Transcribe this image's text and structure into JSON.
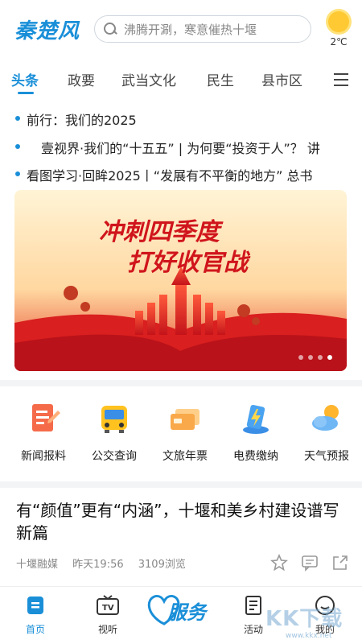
{
  "header": {
    "logo": "秦楚风",
    "search_placeholder": "沸腾开涮，寒意催热十堰",
    "weather": {
      "icon": "sun-icon",
      "temperature": "2℃"
    }
  },
  "tabs": {
    "items": [
      "头条",
      "政要",
      "武当文化",
      "民生",
      "县市区"
    ],
    "active_index": 0,
    "accent": "#1a8fd8"
  },
  "headlines": [
    "前行：我们的2025",
    "壹视界·我们的“十五五” | 为何要“投资于人”？ 讲",
    "看图学习·回眸2025丨“发展有不平衡的地方” 总书"
  ],
  "banner": {
    "title_line1": "冲刺四季度",
    "title_line2": "打好收官战",
    "slide_count": 4,
    "active_slide": 3
  },
  "services": [
    {
      "label": "新闻报料",
      "icon": "news-report-icon"
    },
    {
      "label": "公交查询",
      "icon": "bus-icon"
    },
    {
      "label": "文旅年票",
      "icon": "ticket-card-icon"
    },
    {
      "label": "电费缴纳",
      "icon": "electricity-bill-icon"
    },
    {
      "label": "天气预报",
      "icon": "weather-icon"
    }
  ],
  "article": {
    "title": "有“颜值”更有“内涵”，十堰和美乡村建设谱写新篇",
    "source": "十堰融媒",
    "time": "昨天19:56",
    "views": "3109浏览"
  },
  "bottom_nav": [
    {
      "label": "首页",
      "icon": "home-icon",
      "active": true
    },
    {
      "label": "视听",
      "icon": "tv-icon",
      "active": false
    },
    {
      "label": "服务",
      "icon": "service-heart-icon",
      "active": false
    },
    {
      "label": "活动",
      "icon": "activity-doc-icon",
      "active": false
    },
    {
      "label": "我的",
      "icon": "profile-icon",
      "active": false
    }
  ],
  "watermark": {
    "text": "KK下载",
    "url": "www.kkx.net"
  }
}
